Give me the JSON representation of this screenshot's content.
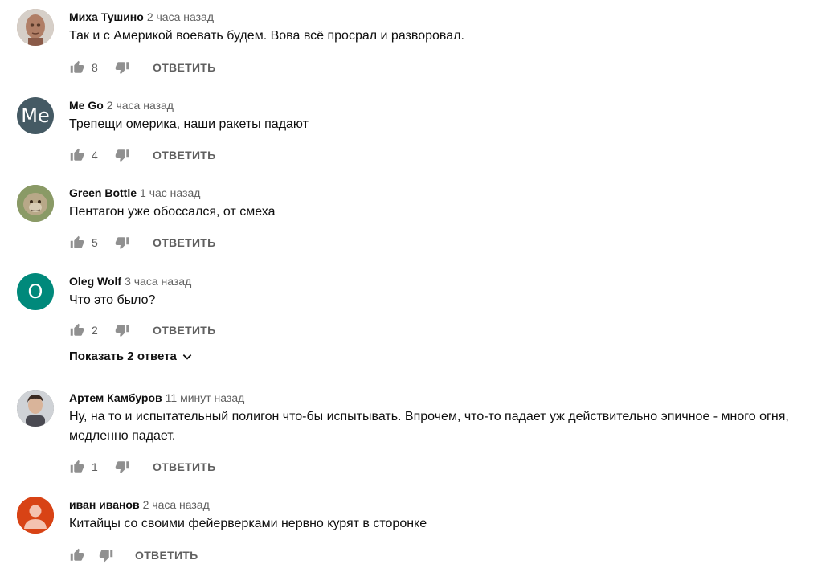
{
  "comments": [
    {
      "author": "Миха Тушино",
      "time": "2 часа назад",
      "text": "Так и с Америкой воевать будем. Вова всё просрал и разворовал.",
      "likes": "8",
      "reply_label": "ОТВЕТИТЬ",
      "avatar": {
        "type": "photo",
        "icon": "bald-head-photo",
        "color": "#a57f6b"
      }
    },
    {
      "author": "Me Go",
      "time": "2 часа назад",
      "text": "Трепещи омерика, наши ракеты падают",
      "likes": "4",
      "reply_label": "ОТВЕТИТЬ",
      "avatar": {
        "type": "letter",
        "letter": "Me",
        "color": "#455a64"
      }
    },
    {
      "author": "Green Bottle",
      "time": "1 час назад",
      "text": "Пентагон уже обоссался, от смеха",
      "likes": "5",
      "reply_label": "ОТВЕТИТЬ",
      "avatar": {
        "type": "photo",
        "icon": "monkey-photo",
        "color": "#7a8a55"
      }
    },
    {
      "author": "Oleg Wolf",
      "time": "3 часа назад",
      "text": "Что это было?",
      "likes": "2",
      "reply_label": "ОТВЕТИТЬ",
      "replies_label": "Показать 2 ответа",
      "avatar": {
        "type": "letter",
        "letter": "O",
        "color": "#00897b"
      }
    },
    {
      "author": "Артем Камбуров",
      "time": "11 минут назад",
      "text_lines": [
        "Ну,  на то и испытательный полигон что-бы испытывать. Впрочем, что-то падает уж  действительно эпичное - много огня,",
        "медленно падает."
      ],
      "likes": "1",
      "reply_label": "ОТВЕТИТЬ",
      "avatar": {
        "type": "photo",
        "icon": "person-photo",
        "color": "#6b6b6b"
      }
    },
    {
      "author": "иван иванов",
      "time": "2 часа назад",
      "text": "Китайцы со своими фейерверками нервно курят в сторонке",
      "likes": "",
      "reply_label": "ОТВЕТИТЬ",
      "avatar": {
        "type": "default",
        "icon": "default-user-icon",
        "color": "#d84315"
      }
    }
  ]
}
